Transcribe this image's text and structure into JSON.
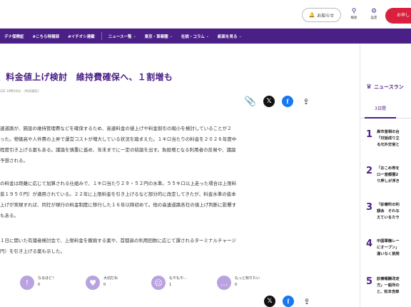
{
  "header": {
    "notif_icon": "bell-icon",
    "notif_label": "お知らせ",
    "search_label": "検索",
    "settings_label": "設定",
    "cta_label": "お申し"
  },
  "nav": {
    "items": [
      {
        "label": "デナ保険証",
        "chevron": false
      },
      {
        "label": "#こちら特報部",
        "chevron": false
      },
      {
        "label": "#イチオシ連載",
        "chevron": false
      },
      {
        "label": "ニュース一覧",
        "chevron": true
      },
      {
        "label": "東京・首都圏",
        "chevron": true
      },
      {
        "label": "社説・コラム",
        "chevron": true
      },
      {
        "label": "紙面を見る",
        "chevron": true
      }
    ]
  },
  "article": {
    "headline": "、料金値上げ検討　維持費確保へ、１割増も",
    "dateline": "2日 19時29分 （共同通信）",
    "paragraphs": [
      [
        "速道路が、施設の維持管理費などを確保するため、高速料金の値上げや料金割引の縮小を検討していることが２",
        "った。物価高や人件費の上昇で運営コストが増大している状況を踏まえた。１キロ当たりの料金を２０２６年度中",
        "程度引き上げる案もある。議論を慎重に進め、年末までに一定の結論を出す。負担増となる利用者の反発や、議論",
        "予想される。"
      ],
      [
        "の料金は距離に応じて加算される仕組みで、１キロ当たり２９・５２円の水準。５５キロ以上走った場合は上限料",
        "普１９５０円）が適用されている。２２年に上限料金を引き上げるなど部分的に改定してきたが、料金水準の抜本",
        "上げが実現すれば、同社が現行の料金制度に移行した１６年以降初めて。他の高速道路各社の値上げ判断に影響す",
        "もある。"
      ],
      [
        "１日に開いた有識者検討会で、上限料金を撤廃する案や、首都高の利用回数に応じて課されるターミナルチャージ",
        "円）を引き上げる案も示した。"
      ]
    ]
  },
  "share": {
    "clip_icon": "paperclip-icon",
    "x_icon": "x-logo-icon",
    "fb_icon": "facebook-icon",
    "share_icon": "share-icon"
  },
  "reactions": [
    {
      "label": "なるほど！",
      "count": "0",
      "icon": "exclamation-icon"
    },
    {
      "label": "大切だね",
      "count": "0",
      "icon": "heart-icon"
    },
    {
      "label": "もやもや…",
      "count": "1",
      "icon": "frown-icon"
    },
    {
      "label": "もっと知りたい",
      "count": "0",
      "icon": "chat-icon"
    }
  ],
  "sidebar": {
    "ranking_title": "ニュースラン",
    "tab_label": "3日間",
    "items": [
      {
        "num": "1",
        "lines": [
          "高市首相の台",
          "「対話成り立",
          "る元外交官と"
        ]
      },
      {
        "num": "2",
        "lines": [
          "「おこめ券を",
          "ロー首都圏2",
          "り押しが浮き"
        ]
      },
      {
        "num": "3",
        "lines": [
          "「診療所の利",
          "額会　それな",
          "えているカラ"
        ]
      },
      {
        "num": "4",
        "lines": [
          "中国軍機レー",
          "にオープン」",
          "違いなく挑発"
        ]
      },
      {
        "num": "5",
        "lines": [
          "診療報酬改定",
          "方」一般所の",
          "と、松本吉郎"
        ]
      }
    ]
  },
  "colors": {
    "brand_purple": "#4a1f86",
    "cta_red": "#d9203e",
    "reaction_lavender": "#b9a2e0"
  }
}
